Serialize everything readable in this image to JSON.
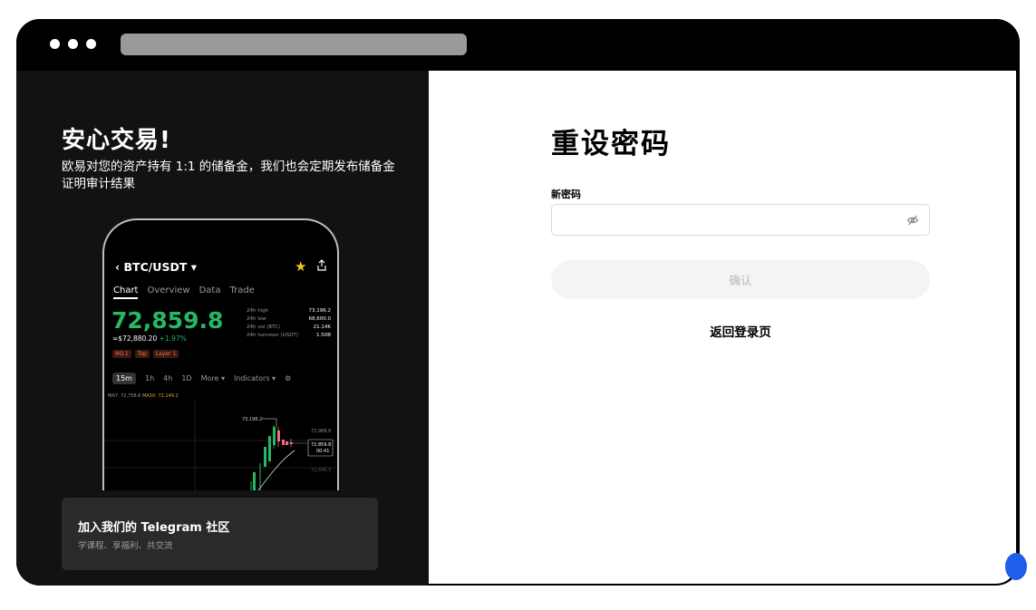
{
  "window": {
    "url": ""
  },
  "promo": {
    "title": "安心交易!",
    "subtitle": "欧易对您的资产持有 1:1 的储备金，我们也会定期发布储备金证明审计结果"
  },
  "phone": {
    "back_icon": "chevron-left-icon",
    "pair": "BTC/USDT",
    "pair_dropdown_icon": "caret-down-icon",
    "favorite_icon": "star-icon",
    "share_icon": "share-icon",
    "tabs": [
      "Chart",
      "Overview",
      "Data",
      "Trade"
    ],
    "price": "72,859.8",
    "usd_price": "≈$72,880.20",
    "change": "+1.97%",
    "badges": [
      "NO.1",
      "Top",
      "Layer 1"
    ],
    "stats": [
      {
        "label": "24h high",
        "value": "73,196.2"
      },
      {
        "label": "24h low",
        "value": "68,600.0"
      },
      {
        "label": "24h vol (BTC)",
        "value": "21.14K"
      },
      {
        "label": "24h turnover (USDT)",
        "value": "1.50B"
      }
    ],
    "intervals": [
      "15m",
      "1h",
      "4h",
      "1D",
      "More ▾",
      "Indicators ▾"
    ],
    "ma7": "MA7: 72,758.6",
    "ma30": "MA30: 72,149.2",
    "chart_labels": {
      "high_marker": "73,196.2",
      "level_1": "72,988.6",
      "current": "72,859.8",
      "countdown": "00:41",
      "level_2": "72,696.5"
    },
    "colors": {
      "up": "#25b865",
      "down": "#f26d7d"
    }
  },
  "telegram": {
    "title": "加入我们的 Telegram 社区",
    "subtitle": "学课程、享福利、共交流"
  },
  "form": {
    "title": "重设密码",
    "new_password_label": "新密码",
    "new_password_value": "",
    "eye_icon": "eye-off-icon",
    "confirm_label": "确认",
    "back_to_login": "返回登录页"
  }
}
